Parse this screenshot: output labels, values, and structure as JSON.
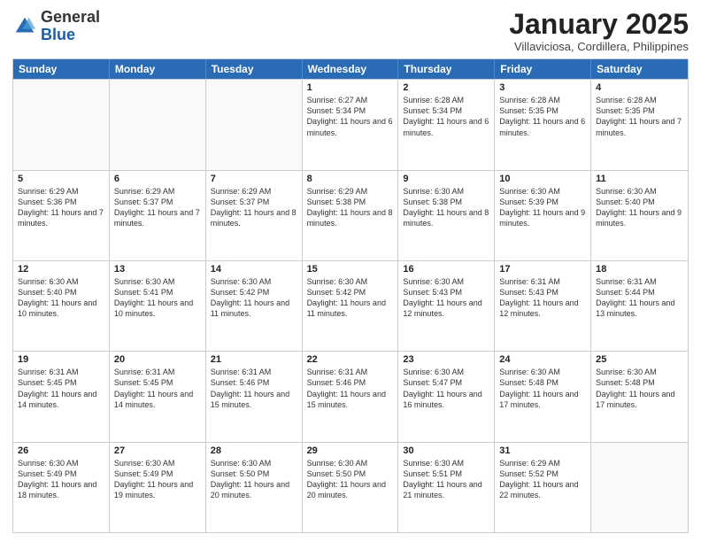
{
  "header": {
    "logo_general": "General",
    "logo_blue": "Blue",
    "month_title": "January 2025",
    "location": "Villaviciosa, Cordillera, Philippines"
  },
  "weekdays": [
    "Sunday",
    "Monday",
    "Tuesday",
    "Wednesday",
    "Thursday",
    "Friday",
    "Saturday"
  ],
  "rows": [
    [
      {
        "date": "",
        "sunrise": "",
        "sunset": "",
        "daylight": "",
        "empty": true
      },
      {
        "date": "",
        "sunrise": "",
        "sunset": "",
        "daylight": "",
        "empty": true
      },
      {
        "date": "",
        "sunrise": "",
        "sunset": "",
        "daylight": "",
        "empty": true
      },
      {
        "date": "1",
        "sunrise": "Sunrise: 6:27 AM",
        "sunset": "Sunset: 5:34 PM",
        "daylight": "Daylight: 11 hours and 6 minutes.",
        "empty": false
      },
      {
        "date": "2",
        "sunrise": "Sunrise: 6:28 AM",
        "sunset": "Sunset: 5:34 PM",
        "daylight": "Daylight: 11 hours and 6 minutes.",
        "empty": false
      },
      {
        "date": "3",
        "sunrise": "Sunrise: 6:28 AM",
        "sunset": "Sunset: 5:35 PM",
        "daylight": "Daylight: 11 hours and 6 minutes.",
        "empty": false
      },
      {
        "date": "4",
        "sunrise": "Sunrise: 6:28 AM",
        "sunset": "Sunset: 5:35 PM",
        "daylight": "Daylight: 11 hours and 7 minutes.",
        "empty": false
      }
    ],
    [
      {
        "date": "5",
        "sunrise": "Sunrise: 6:29 AM",
        "sunset": "Sunset: 5:36 PM",
        "daylight": "Daylight: 11 hours and 7 minutes.",
        "empty": false
      },
      {
        "date": "6",
        "sunrise": "Sunrise: 6:29 AM",
        "sunset": "Sunset: 5:37 PM",
        "daylight": "Daylight: 11 hours and 7 minutes.",
        "empty": false
      },
      {
        "date": "7",
        "sunrise": "Sunrise: 6:29 AM",
        "sunset": "Sunset: 5:37 PM",
        "daylight": "Daylight: 11 hours and 8 minutes.",
        "empty": false
      },
      {
        "date": "8",
        "sunrise": "Sunrise: 6:29 AM",
        "sunset": "Sunset: 5:38 PM",
        "daylight": "Daylight: 11 hours and 8 minutes.",
        "empty": false
      },
      {
        "date": "9",
        "sunrise": "Sunrise: 6:30 AM",
        "sunset": "Sunset: 5:38 PM",
        "daylight": "Daylight: 11 hours and 8 minutes.",
        "empty": false
      },
      {
        "date": "10",
        "sunrise": "Sunrise: 6:30 AM",
        "sunset": "Sunset: 5:39 PM",
        "daylight": "Daylight: 11 hours and 9 minutes.",
        "empty": false
      },
      {
        "date": "11",
        "sunrise": "Sunrise: 6:30 AM",
        "sunset": "Sunset: 5:40 PM",
        "daylight": "Daylight: 11 hours and 9 minutes.",
        "empty": false
      }
    ],
    [
      {
        "date": "12",
        "sunrise": "Sunrise: 6:30 AM",
        "sunset": "Sunset: 5:40 PM",
        "daylight": "Daylight: 11 hours and 10 minutes.",
        "empty": false
      },
      {
        "date": "13",
        "sunrise": "Sunrise: 6:30 AM",
        "sunset": "Sunset: 5:41 PM",
        "daylight": "Daylight: 11 hours and 10 minutes.",
        "empty": false
      },
      {
        "date": "14",
        "sunrise": "Sunrise: 6:30 AM",
        "sunset": "Sunset: 5:42 PM",
        "daylight": "Daylight: 11 hours and 11 minutes.",
        "empty": false
      },
      {
        "date": "15",
        "sunrise": "Sunrise: 6:30 AM",
        "sunset": "Sunset: 5:42 PM",
        "daylight": "Daylight: 11 hours and 11 minutes.",
        "empty": false
      },
      {
        "date": "16",
        "sunrise": "Sunrise: 6:30 AM",
        "sunset": "Sunset: 5:43 PM",
        "daylight": "Daylight: 11 hours and 12 minutes.",
        "empty": false
      },
      {
        "date": "17",
        "sunrise": "Sunrise: 6:31 AM",
        "sunset": "Sunset: 5:43 PM",
        "daylight": "Daylight: 11 hours and 12 minutes.",
        "empty": false
      },
      {
        "date": "18",
        "sunrise": "Sunrise: 6:31 AM",
        "sunset": "Sunset: 5:44 PM",
        "daylight": "Daylight: 11 hours and 13 minutes.",
        "empty": false
      }
    ],
    [
      {
        "date": "19",
        "sunrise": "Sunrise: 6:31 AM",
        "sunset": "Sunset: 5:45 PM",
        "daylight": "Daylight: 11 hours and 14 minutes.",
        "empty": false
      },
      {
        "date": "20",
        "sunrise": "Sunrise: 6:31 AM",
        "sunset": "Sunset: 5:45 PM",
        "daylight": "Daylight: 11 hours and 14 minutes.",
        "empty": false
      },
      {
        "date": "21",
        "sunrise": "Sunrise: 6:31 AM",
        "sunset": "Sunset: 5:46 PM",
        "daylight": "Daylight: 11 hours and 15 minutes.",
        "empty": false
      },
      {
        "date": "22",
        "sunrise": "Sunrise: 6:31 AM",
        "sunset": "Sunset: 5:46 PM",
        "daylight": "Daylight: 11 hours and 15 minutes.",
        "empty": false
      },
      {
        "date": "23",
        "sunrise": "Sunrise: 6:30 AM",
        "sunset": "Sunset: 5:47 PM",
        "daylight": "Daylight: 11 hours and 16 minutes.",
        "empty": false
      },
      {
        "date": "24",
        "sunrise": "Sunrise: 6:30 AM",
        "sunset": "Sunset: 5:48 PM",
        "daylight": "Daylight: 11 hours and 17 minutes.",
        "empty": false
      },
      {
        "date": "25",
        "sunrise": "Sunrise: 6:30 AM",
        "sunset": "Sunset: 5:48 PM",
        "daylight": "Daylight: 11 hours and 17 minutes.",
        "empty": false
      }
    ],
    [
      {
        "date": "26",
        "sunrise": "Sunrise: 6:30 AM",
        "sunset": "Sunset: 5:49 PM",
        "daylight": "Daylight: 11 hours and 18 minutes.",
        "empty": false
      },
      {
        "date": "27",
        "sunrise": "Sunrise: 6:30 AM",
        "sunset": "Sunset: 5:49 PM",
        "daylight": "Daylight: 11 hours and 19 minutes.",
        "empty": false
      },
      {
        "date": "28",
        "sunrise": "Sunrise: 6:30 AM",
        "sunset": "Sunset: 5:50 PM",
        "daylight": "Daylight: 11 hours and 20 minutes.",
        "empty": false
      },
      {
        "date": "29",
        "sunrise": "Sunrise: 6:30 AM",
        "sunset": "Sunset: 5:50 PM",
        "daylight": "Daylight: 11 hours and 20 minutes.",
        "empty": false
      },
      {
        "date": "30",
        "sunrise": "Sunrise: 6:30 AM",
        "sunset": "Sunset: 5:51 PM",
        "daylight": "Daylight: 11 hours and 21 minutes.",
        "empty": false
      },
      {
        "date": "31",
        "sunrise": "Sunrise: 6:29 AM",
        "sunset": "Sunset: 5:52 PM",
        "daylight": "Daylight: 11 hours and 22 minutes.",
        "empty": false
      },
      {
        "date": "",
        "sunrise": "",
        "sunset": "",
        "daylight": "",
        "empty": true
      }
    ]
  ]
}
